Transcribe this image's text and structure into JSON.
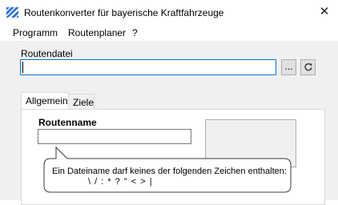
{
  "window": {
    "title": "Routenkonverter für bayerische Kraftfahrzeuge",
    "close_glyph": "✕",
    "icon": "bavarian-flag-icon"
  },
  "menu": {
    "items": [
      "Programm",
      "Routenplaner",
      "?"
    ]
  },
  "file": {
    "label": "Routendatei",
    "value": "",
    "browse_label": "...",
    "refresh_icon": "refresh-icon"
  },
  "tabs": [
    {
      "label": "Allgemein",
      "active": true
    },
    {
      "label": "Ziele",
      "active": false
    }
  ],
  "general": {
    "routenname_label": "Routenname",
    "routenname_value": ""
  },
  "tooltip": {
    "line1": "Ein Dateiname darf keines der folgenden Zeichen enthalten:",
    "line2": "\\ / : * ? \" < > |"
  },
  "colors": {
    "focus_border": "#0078d7",
    "client_bg": "#f0f0f0"
  }
}
